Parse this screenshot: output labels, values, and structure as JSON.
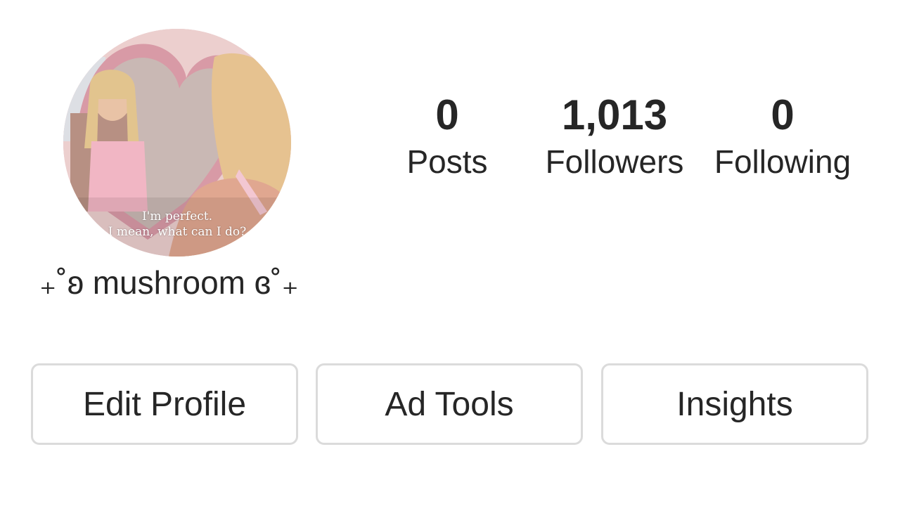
{
  "profile": {
    "avatar_caption_line1": "I'm perfect.",
    "avatar_caption_line2": "I mean, what can I do?",
    "display_name": "₊˚ʚ mushroom ɞ˚₊"
  },
  "stats": {
    "posts": {
      "value": "0",
      "label": "Posts"
    },
    "followers": {
      "value": "1,013",
      "label": "Followers"
    },
    "following": {
      "value": "0",
      "label": "Following"
    }
  },
  "actions": {
    "edit_profile": "Edit Profile",
    "ad_tools": "Ad Tools",
    "insights": "Insights"
  },
  "colors": {
    "text": "#262626",
    "button_border": "#dbdbdb",
    "background": "#ffffff"
  }
}
